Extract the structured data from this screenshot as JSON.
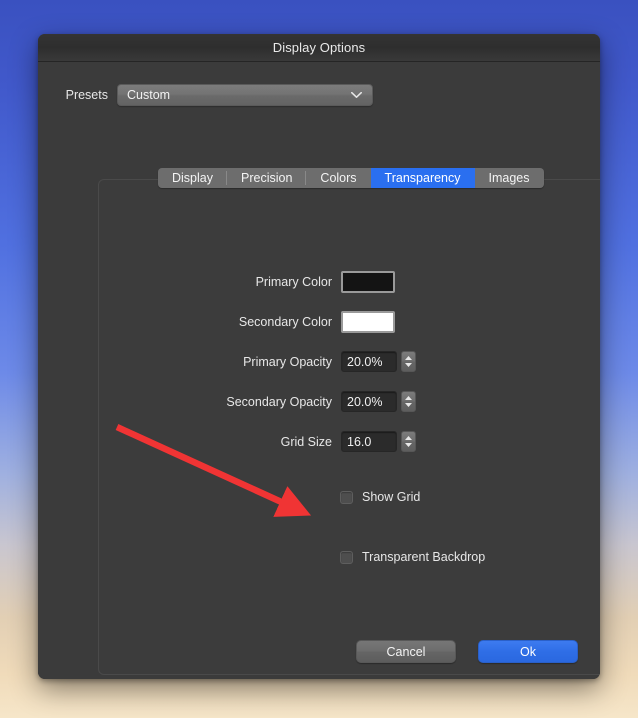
{
  "window": {
    "title": "Display Options"
  },
  "presets": {
    "label": "Presets",
    "value": "Custom",
    "chevron_icon": "chevron-down-icon"
  },
  "tabs": [
    {
      "label": "Display",
      "selected": false
    },
    {
      "label": "Precision",
      "selected": false
    },
    {
      "label": "Colors",
      "selected": false
    },
    {
      "label": "Transparency",
      "selected": true
    },
    {
      "label": "Images",
      "selected": false
    }
  ],
  "fields": {
    "primary_color": {
      "label": "Primary Color",
      "swatch_color": "#141414"
    },
    "secondary_color": {
      "label": "Secondary Color",
      "swatch_color": "#ffffff"
    },
    "primary_opacity": {
      "label": "Primary Opacity",
      "value": "20.0%",
      "stepper_icon": "stepper-up-down-icon"
    },
    "secondary_opacity": {
      "label": "Secondary Opacity",
      "value": "20.0%",
      "stepper_icon": "stepper-up-down-icon"
    },
    "grid_size": {
      "label": "Grid Size",
      "value": "16.0",
      "stepper_icon": "stepper-up-down-icon"
    }
  },
  "checkboxes": [
    {
      "label": "Show Grid",
      "checked": false
    },
    {
      "label": "Transparent Backdrop",
      "checked": false
    }
  ],
  "footer": {
    "cancel_label": "Cancel",
    "ok_label": "Ok"
  },
  "annotation": {
    "arrow_color": "#f03434",
    "points_at": "Transparent Backdrop"
  },
  "colors": {
    "accent": "#2a6ff0",
    "dialog_bg": "#3b3b3b",
    "titlebar_bg": "#2e2e2e",
    "desktop_top": "#3a51c0",
    "desktop_bottom": "#f6e6c9"
  }
}
